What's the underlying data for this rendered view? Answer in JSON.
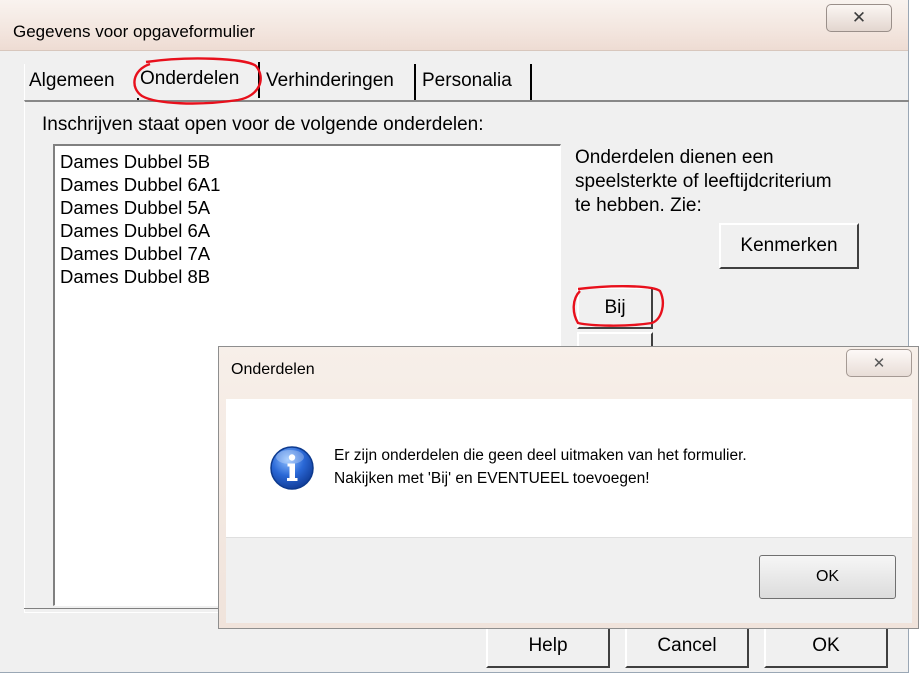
{
  "main_window": {
    "title": "Gegevens voor opgaveformulier",
    "close_glyph": "✕"
  },
  "tabs": [
    {
      "label": "Algemeen"
    },
    {
      "label": "Onderdelen"
    },
    {
      "label": "Verhinderingen"
    },
    {
      "label": "Personalia"
    }
  ],
  "onderdelen_tab": {
    "intro": "Inschrijven staat open voor de volgende onderdelen:",
    "items": [
      "Dames Dubbel 5B",
      "Dames Dubbel 6A1",
      "Dames Dubbel 5A",
      "Dames Dubbel 6A",
      "Dames Dubbel 7A",
      "Dames Dubbel 8B"
    ],
    "info_line1": "Onderdelen dienen een",
    "info_line2": "speelsterkte of leeftijdcriterium",
    "info_line3": "te hebben. Zie:",
    "kenmerken_label": "Kenmerken",
    "bij_label": "Bij"
  },
  "footer": {
    "help_label": "Help",
    "cancel_label": "Cancel",
    "ok_label": "OK"
  },
  "message_box": {
    "title": "Onderdelen",
    "close_glyph": "✕",
    "line1": "Er zijn onderdelen die geen deel uitmaken van het formulier.",
    "line2": "Nakijken met 'Bij' en EVENTUEEL toevoegen!",
    "ok_label": "OK",
    "icon": "info-icon"
  },
  "colors": {
    "annotation_red": "#e8101c",
    "info_icon_blue": "#1f5bc4"
  }
}
